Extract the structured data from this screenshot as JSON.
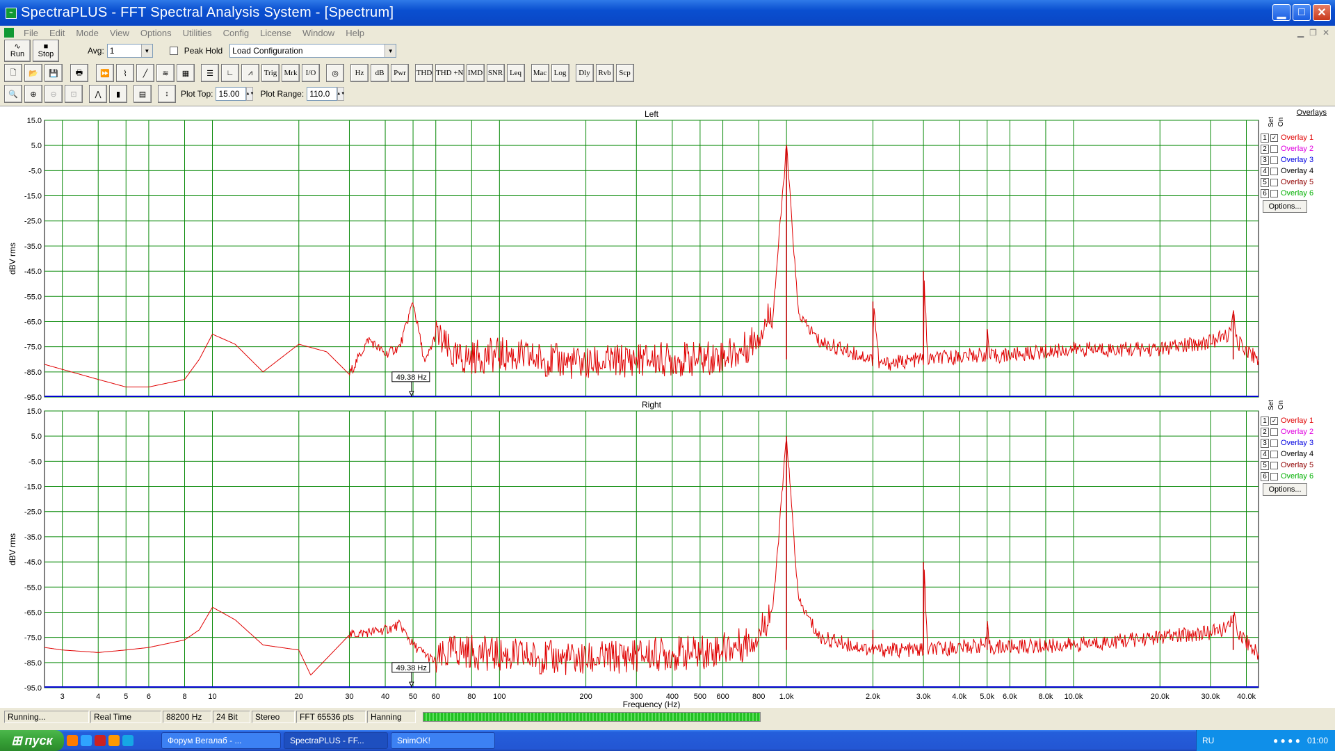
{
  "window": {
    "title": "SpectraPLUS - FFT Spectral Analysis System - [Spectrum]"
  },
  "menu": [
    "File",
    "Edit",
    "Mode",
    "View",
    "Options",
    "Utilities",
    "Config",
    "License",
    "Window",
    "Help"
  ],
  "toolbar1": {
    "run": "Run",
    "stop": "Stop",
    "avg_label": "Avg:",
    "avg_value": "1",
    "peak_hold": "Peak Hold",
    "config_value": "Load Configuration"
  },
  "toolbar2": [
    "Trig",
    "Mrk",
    "I/O",
    "Hz",
    "dB",
    "Pwr",
    "THD",
    "THD +N",
    "IMD",
    "SNR",
    "Leq",
    "Mac",
    "Log",
    "Dly",
    "Rvb",
    "Scp"
  ],
  "toolbar3": {
    "plot_top_label": "Plot Top:",
    "plot_top": "15.00",
    "plot_range_label": "Plot Range:",
    "plot_range": "110.0"
  },
  "plots": [
    {
      "title": "Left",
      "ylabel": "dBV rms",
      "marker": "49.38 Hz"
    },
    {
      "title": "Right",
      "ylabel": "dBV rms",
      "marker": "49.38 Hz"
    }
  ],
  "yticks": [
    "15.0",
    "5.0",
    "-5.0",
    "-15.0",
    "-25.0",
    "-35.0",
    "-45.0",
    "-55.0",
    "-65.0",
    "-75.0",
    "-85.0",
    "-95.0"
  ],
  "xticks": [
    {
      "v": 3,
      "l": "3"
    },
    {
      "v": 4,
      "l": "4"
    },
    {
      "v": 5,
      "l": "5"
    },
    {
      "v": 6,
      "l": "6"
    },
    {
      "v": 8,
      "l": "8"
    },
    {
      "v": 10,
      "l": "10"
    },
    {
      "v": 20,
      "l": "20"
    },
    {
      "v": 30,
      "l": "30"
    },
    {
      "v": 40,
      "l": "40"
    },
    {
      "v": 50,
      "l": "50"
    },
    {
      "v": 60,
      "l": "60"
    },
    {
      "v": 80,
      "l": "80"
    },
    {
      "v": 100,
      "l": "100"
    },
    {
      "v": 200,
      "l": "200"
    },
    {
      "v": 300,
      "l": "300"
    },
    {
      "v": 400,
      "l": "400"
    },
    {
      "v": 500,
      "l": "500"
    },
    {
      "v": 600,
      "l": "600"
    },
    {
      "v": 800,
      "l": "800"
    },
    {
      "v": 1000,
      "l": "1.0k"
    },
    {
      "v": 2000,
      "l": "2.0k"
    },
    {
      "v": 3000,
      "l": "3.0k"
    },
    {
      "v": 4000,
      "l": "4.0k"
    },
    {
      "v": 5000,
      "l": "5.0k"
    },
    {
      "v": 6000,
      "l": "6.0k"
    },
    {
      "v": 8000,
      "l": "8.0k"
    },
    {
      "v": 10000,
      "l": "10.0k"
    },
    {
      "v": 20000,
      "l": "20.0k"
    },
    {
      "v": 30000,
      "l": "30.0k"
    },
    {
      "v": 40000,
      "l": "40.0k"
    }
  ],
  "xlabel": "Frequency (Hz)",
  "overlays": {
    "title": "Overlays",
    "set": "Set",
    "on": "On",
    "options": "Options...",
    "items": [
      {
        "n": "1",
        "name": "Overlay 1",
        "color": "#e00000",
        "checked": true
      },
      {
        "n": "2",
        "name": "Overlay 2",
        "color": "#e000e0",
        "checked": false
      },
      {
        "n": "3",
        "name": "Overlay 3",
        "color": "#0000e0",
        "checked": false
      },
      {
        "n": "4",
        "name": "Overlay 4",
        "color": "#000000",
        "checked": false
      },
      {
        "n": "5",
        "name": "Overlay 5",
        "color": "#900000",
        "checked": false
      },
      {
        "n": "6",
        "name": "Overlay 6",
        "color": "#00b000",
        "checked": false
      }
    ]
  },
  "status": [
    "Running...",
    "Real Time",
    "88200 Hz",
    "24 Bit",
    "Stereo",
    "FFT 65536 pts",
    "Hanning"
  ],
  "taskbar": {
    "start": "пуск",
    "tasks": [
      "Форум Вегалаб - ...",
      "SpectraPLUS - FF...",
      "SnimOK!"
    ],
    "lang": "RU",
    "clock": "01:00"
  },
  "chart_data": [
    {
      "type": "line",
      "title": "Left",
      "ylabel": "dBV rms",
      "xlabel": "Frequency (Hz)",
      "xscale": "log",
      "xlim": [
        2.6,
        44100
      ],
      "ylim": [
        -95,
        15
      ],
      "series": [
        {
          "name": "Overlay 1",
          "color": "#e00000",
          "points": [
            [
              2.6,
              -82
            ],
            [
              3,
              -84
            ],
            [
              4,
              -88
            ],
            [
              5,
              -91
            ],
            [
              6,
              -91
            ],
            [
              8,
              -88
            ],
            [
              9,
              -80
            ],
            [
              10,
              -70
            ],
            [
              12,
              -74
            ],
            [
              15,
              -85
            ],
            [
              20,
              -74
            ],
            [
              25,
              -77
            ],
            [
              30,
              -86
            ],
            [
              35,
              -72
            ],
            [
              40,
              -78
            ],
            [
              45,
              -75
            ],
            [
              50,
              -57
            ],
            [
              55,
              -82
            ],
            [
              60,
              -70
            ],
            [
              70,
              -80
            ],
            [
              100,
              -78
            ],
            [
              200,
              -82
            ],
            [
              300,
              -80
            ],
            [
              500,
              -80
            ],
            [
              700,
              -77
            ],
            [
              800,
              -70
            ],
            [
              900,
              -60
            ],
            [
              1000,
              5
            ],
            [
              1100,
              -62
            ],
            [
              1300,
              -73
            ],
            [
              2000,
              -80
            ],
            [
              2010,
              -57
            ],
            [
              2100,
              -82
            ],
            [
              3000,
              -80
            ],
            [
              3010,
              -45
            ],
            [
              3100,
              -80
            ],
            [
              5000,
              -78
            ],
            [
              5010,
              -68
            ],
            [
              5100,
              -79
            ],
            [
              10000,
              -76
            ],
            [
              20000,
              -76
            ],
            [
              30000,
              -73
            ],
            [
              35000,
              -70
            ],
            [
              36000,
              -62
            ],
            [
              37000,
              -73
            ],
            [
              44100,
              -80
            ]
          ]
        }
      ]
    },
    {
      "type": "line",
      "title": "Right",
      "ylabel": "dBV rms",
      "xlabel": "Frequency (Hz)",
      "xscale": "log",
      "xlim": [
        2.6,
        44100
      ],
      "ylim": [
        -95,
        15
      ],
      "series": [
        {
          "name": "Overlay 1",
          "color": "#e00000",
          "points": [
            [
              2.6,
              -79
            ],
            [
              3,
              -80
            ],
            [
              4,
              -81
            ],
            [
              5,
              -80
            ],
            [
              6,
              -79
            ],
            [
              8,
              -76
            ],
            [
              9,
              -72
            ],
            [
              10,
              -63
            ],
            [
              12,
              -68
            ],
            [
              15,
              -78
            ],
            [
              20,
              -80
            ],
            [
              22,
              -90
            ],
            [
              30,
              -74
            ],
            [
              40,
              -72
            ],
            [
              45,
              -70
            ],
            [
              50,
              -78
            ],
            [
              60,
              -85
            ],
            [
              70,
              -80
            ],
            [
              100,
              -82
            ],
            [
              200,
              -84
            ],
            [
              300,
              -82
            ],
            [
              500,
              -81
            ],
            [
              700,
              -78
            ],
            [
              800,
              -74
            ],
            [
              900,
              -62
            ],
            [
              1000,
              5
            ],
            [
              1100,
              -60
            ],
            [
              1300,
              -75
            ],
            [
              2000,
              -80
            ],
            [
              3000,
              -80
            ],
            [
              3010,
              -46
            ],
            [
              3100,
              -80
            ],
            [
              5000,
              -78
            ],
            [
              5010,
              -71
            ],
            [
              5100,
              -79
            ],
            [
              10000,
              -78
            ],
            [
              20000,
              -75
            ],
            [
              30000,
              -73
            ],
            [
              35000,
              -71
            ],
            [
              36000,
              -66
            ],
            [
              37000,
              -72
            ],
            [
              44100,
              -82
            ]
          ]
        }
      ]
    }
  ]
}
